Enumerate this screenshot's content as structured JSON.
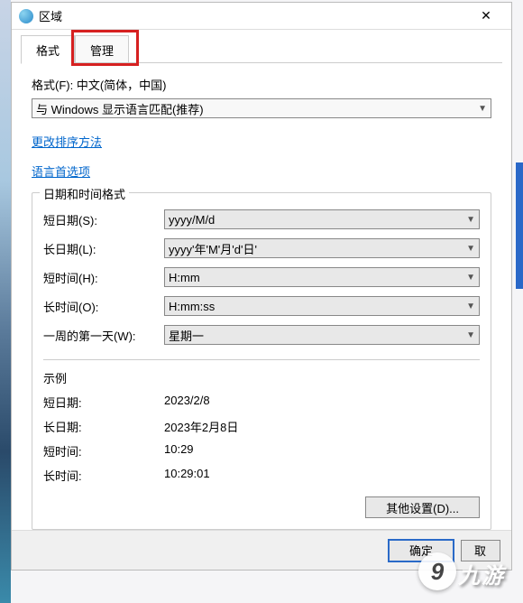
{
  "window": {
    "title": "区域",
    "close": "✕"
  },
  "tabs": {
    "format": "格式",
    "admin": "管理"
  },
  "format_section": {
    "label": "格式(F): 中文(简体，中国)",
    "match_display_lang": "与 Windows 显示语言匹配(推荐)"
  },
  "links": {
    "change_sort": "更改排序方法",
    "language_prefs": "语言首选项"
  },
  "datetime_group": {
    "title": "日期和时间格式",
    "short_date_label": "短日期(S):",
    "short_date_value": "yyyy/M/d",
    "long_date_label": "长日期(L):",
    "long_date_value": "yyyy'年'M'月'd'日'",
    "short_time_label": "短时间(H):",
    "short_time_value": "H:mm",
    "long_time_label": "长时间(O):",
    "long_time_value": "H:mm:ss",
    "first_day_label": "一周的第一天(W):",
    "first_day_value": "星期一"
  },
  "examples": {
    "title": "示例",
    "short_date_label": "短日期:",
    "short_date_value": "2023/2/8",
    "long_date_label": "长日期:",
    "long_date_value": "2023年2月8日",
    "short_time_label": "短时间:",
    "short_time_value": "10:29",
    "long_time_label": "长时间:",
    "long_time_value": "10:29:01"
  },
  "buttons": {
    "other_settings": "其他设置(D)...",
    "ok": "确定",
    "cancel": "取"
  },
  "watermark": {
    "g": "9",
    "txt": "九游"
  }
}
